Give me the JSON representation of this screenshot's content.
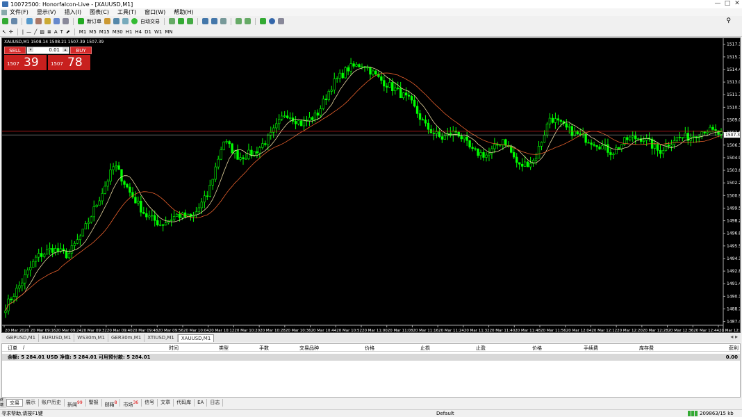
{
  "window": {
    "title": "10072500: Honorfalcon-Live - [XAUUSD,M1]"
  },
  "menu": [
    "文件(F)",
    "显示(V)",
    "插入(I)",
    "图表(C)",
    "工具(T)",
    "窗口(W)",
    "帮助(H)"
  ],
  "toolbar": {
    "new_order": "新订单",
    "auto_trading": "自动交易",
    "timeframes": [
      "M1",
      "M5",
      "M15",
      "M30",
      "H1",
      "H4",
      "D1",
      "W1",
      "MN"
    ]
  },
  "chart": {
    "symbol_label": "XAUUSD,M1  1508.14 1508.21 1507.39 1507.39",
    "current_price_tag": "1507.39"
  },
  "trade_panel": {
    "sell": "SELL",
    "buy": "BUY",
    "lot": "0.01",
    "bid_small": "1507",
    "bid_big": "39",
    "ask_small": "1507",
    "ask_big": "78"
  },
  "chart_data": {
    "type": "candlestick",
    "y_ticks": [
      "1517.10",
      "1515.75",
      "1514.40",
      "1513.05",
      "1511.70",
      "1510.35",
      "1509.00",
      "1507.65",
      "1506.30",
      "1504.95",
      "1503.60",
      "1502.25",
      "1500.90",
      "1499.55",
      "1498.20",
      "1496.85",
      "1495.50",
      "1494.15",
      "1492.80",
      "1491.45",
      "1490.10",
      "1488.75",
      "1487.40"
    ],
    "x_ticks": [
      "20 Mar 2020",
      "20 Mar 09:16",
      "20 Mar 09:24",
      "20 Mar 09:32",
      "20 Mar 09:40",
      "20 Mar 09:48",
      "20 Mar 09:56",
      "20 Mar 10:04",
      "20 Mar 10:12",
      "20 Mar 10:20",
      "20 Mar 10:28",
      "20 Mar 10:36",
      "20 Mar 10:44",
      "20 Mar 10:52",
      "20 Mar 11:00",
      "20 Mar 11:08",
      "20 Mar 11:16",
      "20 Mar 11:24",
      "20 Mar 11:32",
      "20 Mar 11:40",
      "20 Mar 11:48",
      "20 Mar 11:56",
      "20 Mar 12:04",
      "20 Mar 12:12",
      "20 Mar 12:20",
      "20 Mar 12:28",
      "20 Mar 12:36",
      "20 Mar 12:44",
      "20 Mar 12:52"
    ],
    "ylim": [
      1487.0,
      1517.6
    ],
    "close_anchors": [
      1489.0,
      1491.5,
      1494.3,
      1495.2,
      1494.5,
      1497.0,
      1500.5,
      1504.2,
      1501.2,
      1498.8,
      1497.8,
      1498.8,
      1498.5,
      1501.0,
      1506.8,
      1505.0,
      1505.5,
      1507.2,
      1509.8,
      1508.6,
      1509.5,
      1512.8,
      1514.5,
      1515.0,
      1513.4,
      1512.3,
      1511.0,
      1508.3,
      1507.0,
      1507.8,
      1505.6,
      1505.2,
      1507.0,
      1504.0,
      1504.7,
      1509.3,
      1508.1,
      1507.2,
      1506.5,
      1505.5,
      1507.0,
      1507.1,
      1505.6,
      1507.0,
      1507.2,
      1508.0,
      1507.4
    ],
    "levels": {
      "bid": 1507.39,
      "ask": 1507.78
    },
    "colors": {
      "bull": "#00ff00",
      "bear": "#00ff00",
      "ma_fast": "#e8d8a0",
      "ma_slow": "#e8602c",
      "bid_line": "#c0c0c0",
      "ask_line": "#d02020"
    }
  },
  "chart_tabs": [
    "GBPUSD,M1",
    "EURUSD,M1",
    "WS30m,M1",
    "GER30m,M1",
    "XTIUSD,M1",
    "XAUUSD,M1"
  ],
  "terminal": {
    "columns": [
      "订单",
      "/",
      "时间",
      "类型",
      "手数",
      "交易品种",
      "价格",
      "止损",
      "止盈",
      "价格",
      "手续费",
      "库存费",
      "获利"
    ],
    "summary": "余额: 5 284.01 USD  净值: 5 284.01  可用预付款: 5 284.01",
    "summary_value": "0.00",
    "side_label": "终端",
    "tabs": [
      {
        "label": "交易"
      },
      {
        "label": "展示"
      },
      {
        "label": "账户历史"
      },
      {
        "label": "新闻",
        "badge": "99"
      },
      {
        "label": "警报"
      },
      {
        "label": "邮箱",
        "badge": "8"
      },
      {
        "label": "市场",
        "badge": "36"
      },
      {
        "label": "信号"
      },
      {
        "label": "文章"
      },
      {
        "label": "代码库"
      },
      {
        "label": "EA"
      },
      {
        "label": "日志"
      }
    ]
  },
  "status": {
    "help": "寻求帮助,请按F1键",
    "profile": "Default",
    "traffic": "209863/15 kb"
  }
}
